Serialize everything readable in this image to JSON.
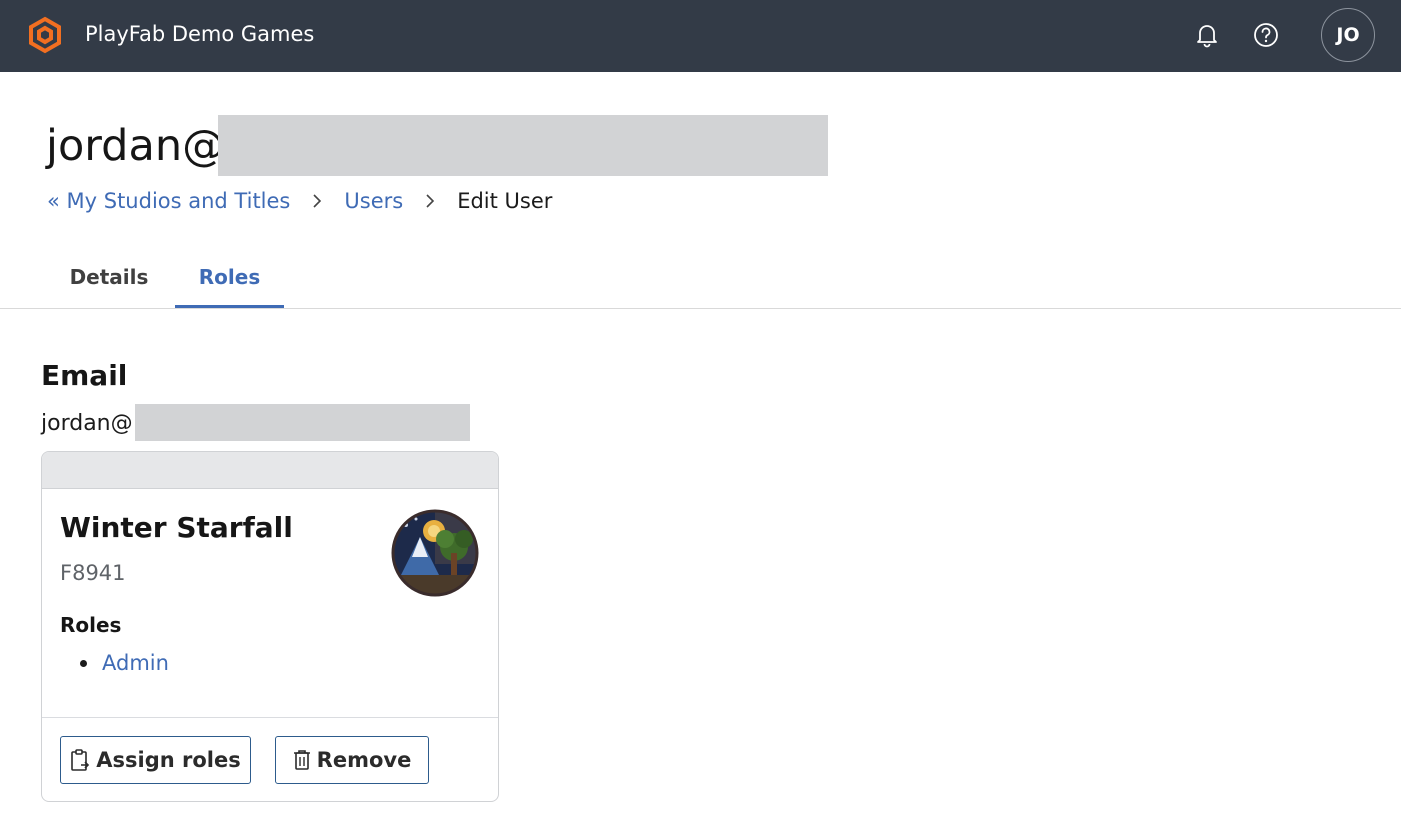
{
  "app": {
    "title": "PlayFab Demo Games",
    "user_initials": "JO"
  },
  "icons": {
    "logo": "playfab-logo-icon",
    "notifications": "bell-icon",
    "help": "help-icon",
    "breadcrumb_separator": "chevron-right-icon",
    "assign": "clipboard-icon",
    "remove": "trash-icon"
  },
  "colors": {
    "topbar": "#333b47",
    "accent": "#3f6bb5",
    "logo": "#f26f21",
    "redaction": "#d2d3d5"
  },
  "header": {
    "title_prefix": "jordan@"
  },
  "breadcrumb": {
    "back_link": "« My Studios and Titles",
    "users_link": "Users",
    "current": "Edit User"
  },
  "tabs": [
    {
      "label": "Details",
      "active": false
    },
    {
      "label": "Roles",
      "active": true
    }
  ],
  "email_section": {
    "title": "Email",
    "value_prefix": "jordan@"
  },
  "title_card": {
    "name": "Winter Starfall",
    "id": "F8941",
    "roles_label": "Roles",
    "roles": [
      "Admin"
    ],
    "assign_button": "Assign roles",
    "remove_button": "Remove"
  }
}
